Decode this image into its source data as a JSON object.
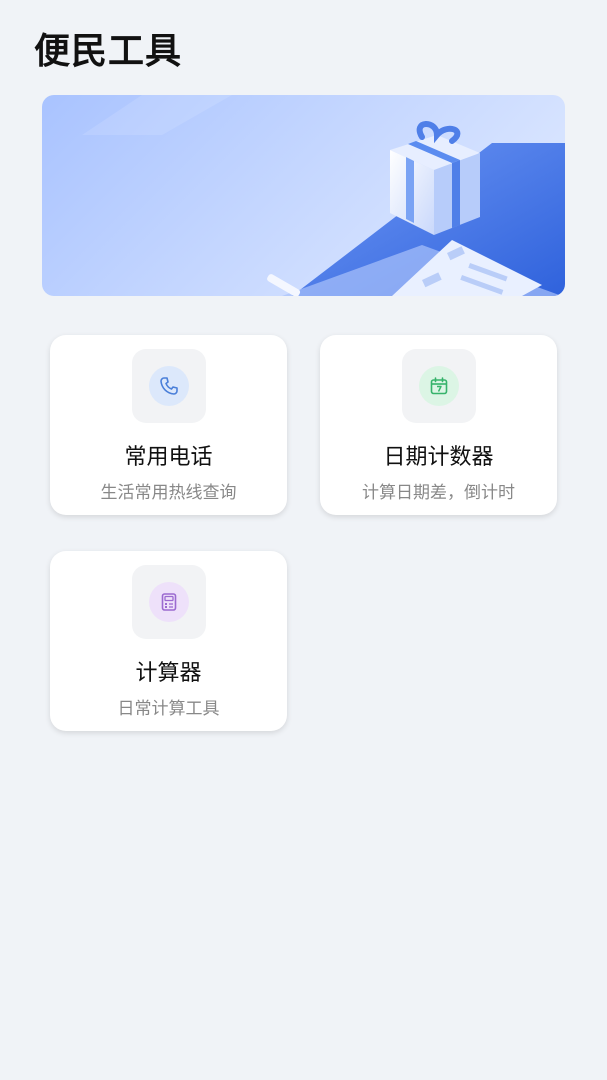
{
  "header": {
    "title": "便民工具"
  },
  "tools": [
    {
      "title": "常用电话",
      "subtitle": "生活常用热线查询",
      "icon": "phone-icon",
      "icon_color": "#4a7fd9",
      "icon_bg": "#dce8fb"
    },
    {
      "title": "日期计数器",
      "subtitle": "计算日期差，倒计时",
      "icon": "calendar-icon",
      "icon_color": "#36b36b",
      "icon_bg": "#dcf5e5"
    },
    {
      "title": "计算器",
      "subtitle": "日常计算工具",
      "icon": "calculator-icon",
      "icon_color": "#9b6ad0",
      "icon_bg": "#eee1fa"
    }
  ],
  "colors": {
    "background": "#f0f3f7",
    "banner_accent": "#3f73e6"
  }
}
